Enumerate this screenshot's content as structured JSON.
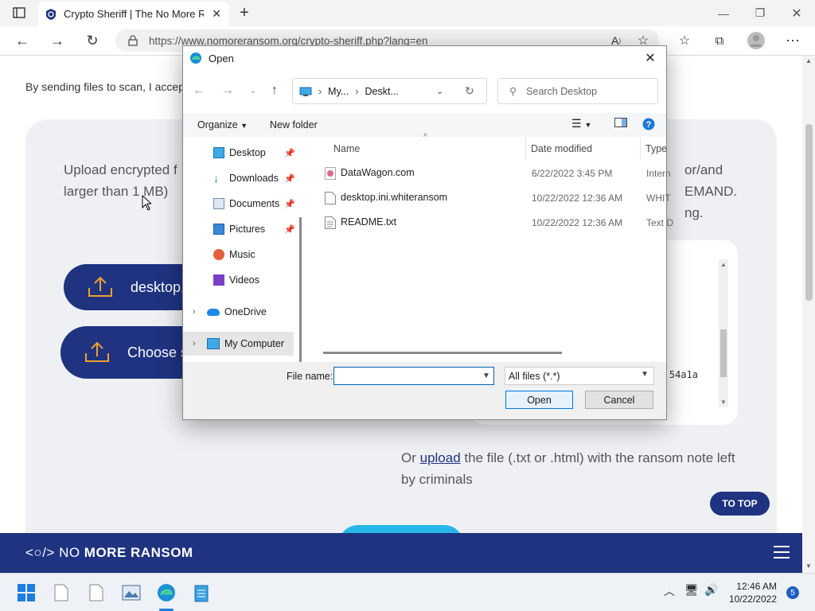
{
  "browser": {
    "tab_title": "Crypto Sheriff | The No More Ra",
    "url": "https://www.nomoreransom.org/crypto-sheriff.php?lang=en"
  },
  "page": {
    "consent_text": "By sending files to scan, I accept",
    "upload_text": "Upload encrypted f larger than 1 MB)",
    "right_text_1": "or/and",
    "right_text_2": "EMAND.",
    "right_text_3": "ng.",
    "pill_1_label": "desktop.",
    "pill_2_label": "Choose s",
    "hash_fragment": "54a1a",
    "or_prefix": "Or",
    "or_link": "upload",
    "or_suffix": " the file (.txt or .html) with the ransom note left by criminals",
    "to_top": "TO TOP",
    "footer_logo_pre": "<○/> NO ",
    "footer_logo_bold": "MORE RANSOM"
  },
  "dialog": {
    "title": "Open",
    "path": [
      "My...",
      "Deskt..."
    ],
    "search_placeholder": "Search Desktop",
    "organize": "Organize",
    "new_folder": "New folder",
    "nav_items": [
      {
        "label": "Desktop",
        "icon": "desktop-icon",
        "pinned": true
      },
      {
        "label": "Downloads",
        "icon": "download-icon",
        "pinned": true
      },
      {
        "label": "Documents",
        "icon": "documents-icon",
        "pinned": true
      },
      {
        "label": "Pictures",
        "icon": "pictures-icon",
        "pinned": true
      },
      {
        "label": "Music",
        "icon": "music-icon",
        "pinned": false
      },
      {
        "label": "Videos",
        "icon": "videos-icon",
        "pinned": false
      },
      {
        "label": "OneDrive",
        "icon": "cloud-icon",
        "pinned": false
      },
      {
        "label": "My Computer",
        "icon": "computer-icon",
        "pinned": false
      }
    ],
    "columns": {
      "name": "Name",
      "date": "Date modified",
      "type": "Type"
    },
    "files": [
      {
        "name": "DataWagon.com",
        "date": "6/22/2022 3:45 PM",
        "type": "Intern"
      },
      {
        "name": "desktop.ini.whiteransom",
        "date": "10/22/2022 12:36 AM",
        "type": "WHIT"
      },
      {
        "name": "README.txt",
        "date": "10/22/2022 12:36 AM",
        "type": "Text D"
      }
    ],
    "file_name_label": "File name:",
    "file_name_value": "",
    "filter": "All files (*.*)",
    "open_button": "Open",
    "cancel_button": "Cancel"
  },
  "taskbar": {
    "time": "12:46 AM",
    "date": "10/22/2022",
    "notifications": "5"
  },
  "colors": {
    "brand": "#1f3381",
    "accent": "#27b7e8"
  }
}
